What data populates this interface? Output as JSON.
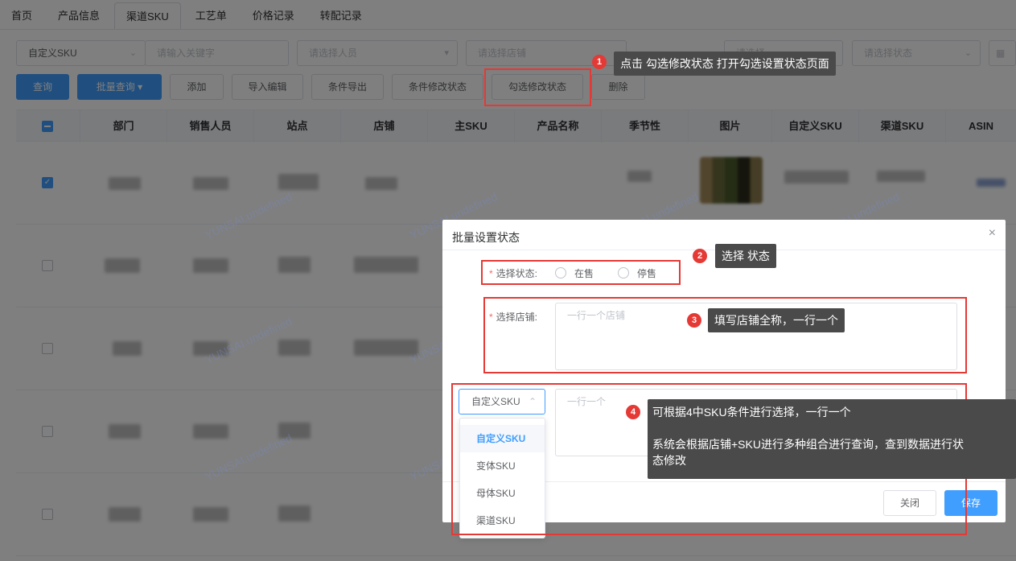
{
  "tabs": [
    "首页",
    "产品信息",
    "渠道SKU",
    "工艺单",
    "价格记录",
    "转配记录"
  ],
  "active_tab": 2,
  "filters": {
    "sku_type": "自定义SKU",
    "keyword_placeholder": "请输入关键字",
    "person_placeholder": "请选择人员",
    "store_placeholder": "请选择店铺",
    "partial_placeholder": "请选择",
    "status_placeholder": "请选择状态"
  },
  "toolbar": {
    "query": "查询",
    "batch_query": "批量查询",
    "add": "添加",
    "import_edit": "导入编辑",
    "cond_export": "条件导出",
    "cond_modify_status": "条件修改状态",
    "check_modify_status": "勾选修改状态",
    "delete": "删除"
  },
  "table": {
    "headers": [
      "部门",
      "销售人员",
      "站点",
      "店铺",
      "主SKU",
      "产品名称",
      "季节性",
      "图片",
      "自定义SKU",
      "渠道SKU",
      "ASIN"
    ]
  },
  "watermark": "YUNSAI.undefined",
  "dialog": {
    "title": "批量设置状态",
    "close_icon": "×",
    "status_label": "选择状态:",
    "status_options": [
      "在售",
      "停售"
    ],
    "store_label": "选择店铺:",
    "store_placeholder": "一行一个店铺",
    "sku_select_value": "自定义SKU",
    "sku_placeholder": "一行一个",
    "sku_options": [
      "自定义SKU",
      "变体SKU",
      "母体SKU",
      "渠道SKU"
    ],
    "close_button": "关闭",
    "save_button": "保存"
  },
  "annotations": [
    {
      "num": "1",
      "text": "点击 勾选修改状态 打开勾选设置状态页面"
    },
    {
      "num": "2",
      "text": "选择 状态"
    },
    {
      "num": "3",
      "text": "填写店铺全称，一行一个"
    },
    {
      "num": "4",
      "text": "可根据4中SKU条件进行选择，一行一个",
      "text2": "系统会根据店铺+SKU进行多种组合进行查询，查到数据进行状",
      "text3": "态修改"
    }
  ],
  "colors": {
    "primary": "#409eff",
    "annotation_red": "#e53935",
    "tooltip": "#4a4a4a"
  }
}
